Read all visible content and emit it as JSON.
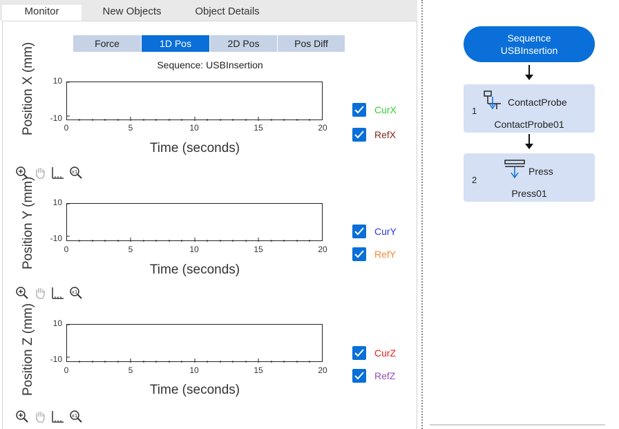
{
  "tabs": [
    {
      "label": "Monitor",
      "active": true
    },
    {
      "label": "New Objects",
      "active": false
    },
    {
      "label": "Object Details",
      "active": false
    }
  ],
  "subtabs": [
    {
      "label": "Force",
      "active": false
    },
    {
      "label": "1D Pos",
      "active": true
    },
    {
      "label": "2D Pos",
      "active": false
    },
    {
      "label": "Pos Diff",
      "active": false
    }
  ],
  "sequence_title": "Sequence: USBInsertion",
  "charts": [
    {
      "ylabel": "Position X (mm)",
      "xlabel": "Time (seconds)",
      "y_ticks": [
        "10",
        "-10"
      ],
      "x_ticks": [
        "0",
        "5",
        "10",
        "15",
        "20"
      ],
      "series": [
        {
          "label": "CurX",
          "checked": true,
          "color": "#2ed12e"
        },
        {
          "label": "RefX",
          "checked": true,
          "color": "#7a2a1a"
        }
      ]
    },
    {
      "ylabel": "Position Y (mm)",
      "xlabel": "Time (seconds)",
      "y_ticks": [
        "10",
        "-10"
      ],
      "x_ticks": [
        "0",
        "5",
        "10",
        "15",
        "20"
      ],
      "series": [
        {
          "label": "CurY",
          "checked": true,
          "color": "#2a36e0"
        },
        {
          "label": "RefY",
          "checked": true,
          "color": "#f08a3a"
        }
      ]
    },
    {
      "ylabel": "Position Z (mm)",
      "xlabel": "Time (seconds)",
      "y_ticks": [
        "10",
        "-10"
      ],
      "x_ticks": [
        "0",
        "5",
        "10",
        "15",
        "20"
      ],
      "series": [
        {
          "label": "CurZ",
          "checked": true,
          "color": "#e0201a"
        },
        {
          "label": "RefZ",
          "checked": true,
          "color": "#9a4ab4"
        }
      ]
    }
  ],
  "chart_toolbar_icons": [
    "zoom-in-icon",
    "pan-hand-icon",
    "box-zoom-icon",
    "zoom-reset-icon"
  ],
  "flow": {
    "start_line1": "Sequence",
    "start_line2": "USBInsertion",
    "steps": [
      {
        "number": "1",
        "type": "ContactProbe",
        "name": "ContactProbe01",
        "icon": "contact-probe-icon"
      },
      {
        "number": "2",
        "type": "Press",
        "name": "Press01",
        "icon": "press-icon"
      }
    ]
  }
}
